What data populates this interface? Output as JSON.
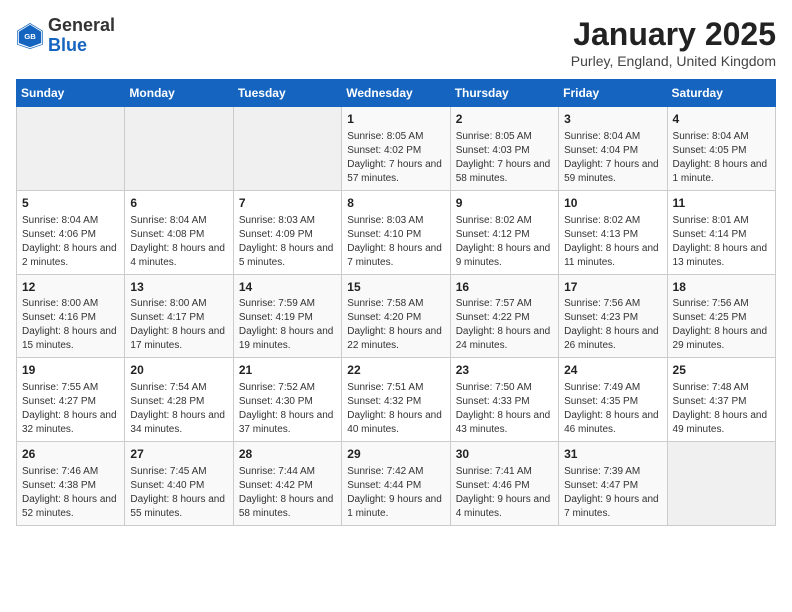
{
  "header": {
    "logo_general": "General",
    "logo_blue": "Blue",
    "title": "January 2025",
    "subtitle": "Purley, England, United Kingdom"
  },
  "weekdays": [
    "Sunday",
    "Monday",
    "Tuesday",
    "Wednesday",
    "Thursday",
    "Friday",
    "Saturday"
  ],
  "weeks": [
    [
      {
        "day": "",
        "info": ""
      },
      {
        "day": "",
        "info": ""
      },
      {
        "day": "",
        "info": ""
      },
      {
        "day": "1",
        "info": "Sunrise: 8:05 AM\nSunset: 4:02 PM\nDaylight: 7 hours and 57 minutes."
      },
      {
        "day": "2",
        "info": "Sunrise: 8:05 AM\nSunset: 4:03 PM\nDaylight: 7 hours and 58 minutes."
      },
      {
        "day": "3",
        "info": "Sunrise: 8:04 AM\nSunset: 4:04 PM\nDaylight: 7 hours and 59 minutes."
      },
      {
        "day": "4",
        "info": "Sunrise: 8:04 AM\nSunset: 4:05 PM\nDaylight: 8 hours and 1 minute."
      }
    ],
    [
      {
        "day": "5",
        "info": "Sunrise: 8:04 AM\nSunset: 4:06 PM\nDaylight: 8 hours and 2 minutes."
      },
      {
        "day": "6",
        "info": "Sunrise: 8:04 AM\nSunset: 4:08 PM\nDaylight: 8 hours and 4 minutes."
      },
      {
        "day": "7",
        "info": "Sunrise: 8:03 AM\nSunset: 4:09 PM\nDaylight: 8 hours and 5 minutes."
      },
      {
        "day": "8",
        "info": "Sunrise: 8:03 AM\nSunset: 4:10 PM\nDaylight: 8 hours and 7 minutes."
      },
      {
        "day": "9",
        "info": "Sunrise: 8:02 AM\nSunset: 4:12 PM\nDaylight: 8 hours and 9 minutes."
      },
      {
        "day": "10",
        "info": "Sunrise: 8:02 AM\nSunset: 4:13 PM\nDaylight: 8 hours and 11 minutes."
      },
      {
        "day": "11",
        "info": "Sunrise: 8:01 AM\nSunset: 4:14 PM\nDaylight: 8 hours and 13 minutes."
      }
    ],
    [
      {
        "day": "12",
        "info": "Sunrise: 8:00 AM\nSunset: 4:16 PM\nDaylight: 8 hours and 15 minutes."
      },
      {
        "day": "13",
        "info": "Sunrise: 8:00 AM\nSunset: 4:17 PM\nDaylight: 8 hours and 17 minutes."
      },
      {
        "day": "14",
        "info": "Sunrise: 7:59 AM\nSunset: 4:19 PM\nDaylight: 8 hours and 19 minutes."
      },
      {
        "day": "15",
        "info": "Sunrise: 7:58 AM\nSunset: 4:20 PM\nDaylight: 8 hours and 22 minutes."
      },
      {
        "day": "16",
        "info": "Sunrise: 7:57 AM\nSunset: 4:22 PM\nDaylight: 8 hours and 24 minutes."
      },
      {
        "day": "17",
        "info": "Sunrise: 7:56 AM\nSunset: 4:23 PM\nDaylight: 8 hours and 26 minutes."
      },
      {
        "day": "18",
        "info": "Sunrise: 7:56 AM\nSunset: 4:25 PM\nDaylight: 8 hours and 29 minutes."
      }
    ],
    [
      {
        "day": "19",
        "info": "Sunrise: 7:55 AM\nSunset: 4:27 PM\nDaylight: 8 hours and 32 minutes."
      },
      {
        "day": "20",
        "info": "Sunrise: 7:54 AM\nSunset: 4:28 PM\nDaylight: 8 hours and 34 minutes."
      },
      {
        "day": "21",
        "info": "Sunrise: 7:52 AM\nSunset: 4:30 PM\nDaylight: 8 hours and 37 minutes."
      },
      {
        "day": "22",
        "info": "Sunrise: 7:51 AM\nSunset: 4:32 PM\nDaylight: 8 hours and 40 minutes."
      },
      {
        "day": "23",
        "info": "Sunrise: 7:50 AM\nSunset: 4:33 PM\nDaylight: 8 hours and 43 minutes."
      },
      {
        "day": "24",
        "info": "Sunrise: 7:49 AM\nSunset: 4:35 PM\nDaylight: 8 hours and 46 minutes."
      },
      {
        "day": "25",
        "info": "Sunrise: 7:48 AM\nSunset: 4:37 PM\nDaylight: 8 hours and 49 minutes."
      }
    ],
    [
      {
        "day": "26",
        "info": "Sunrise: 7:46 AM\nSunset: 4:38 PM\nDaylight: 8 hours and 52 minutes."
      },
      {
        "day": "27",
        "info": "Sunrise: 7:45 AM\nSunset: 4:40 PM\nDaylight: 8 hours and 55 minutes."
      },
      {
        "day": "28",
        "info": "Sunrise: 7:44 AM\nSunset: 4:42 PM\nDaylight: 8 hours and 58 minutes."
      },
      {
        "day": "29",
        "info": "Sunrise: 7:42 AM\nSunset: 4:44 PM\nDaylight: 9 hours and 1 minute."
      },
      {
        "day": "30",
        "info": "Sunrise: 7:41 AM\nSunset: 4:46 PM\nDaylight: 9 hours and 4 minutes."
      },
      {
        "day": "31",
        "info": "Sunrise: 7:39 AM\nSunset: 4:47 PM\nDaylight: 9 hours and 7 minutes."
      },
      {
        "day": "",
        "info": ""
      }
    ]
  ]
}
